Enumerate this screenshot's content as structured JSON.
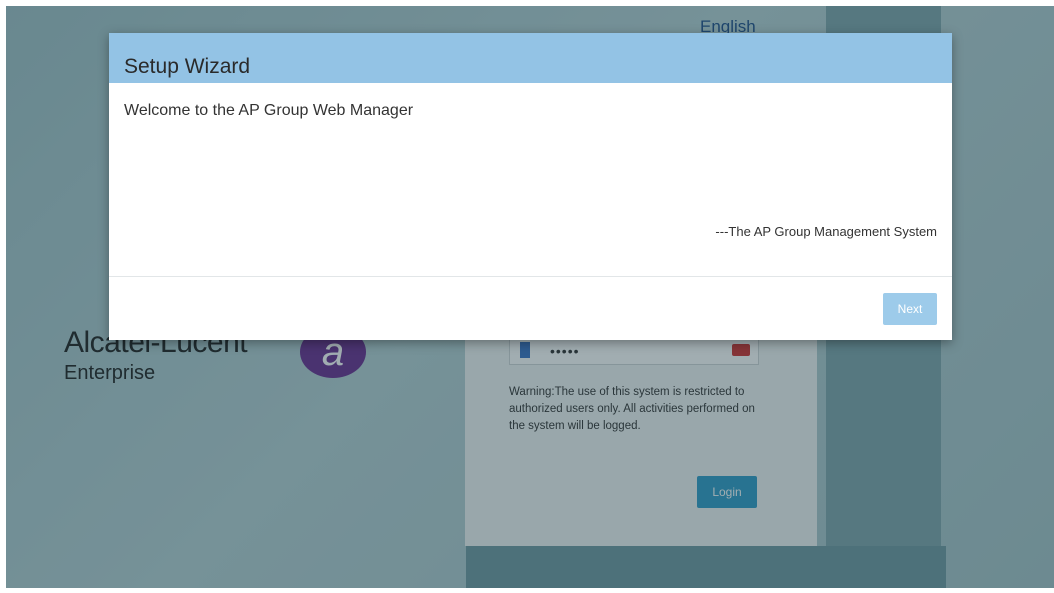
{
  "header": {
    "language": "English"
  },
  "brand": {
    "name": "Alcatel-Lucent",
    "sub": "Enterprise",
    "mark": "a"
  },
  "login": {
    "password_value": "•••••",
    "warning": "Warning:The use of this system is restricted to authorized users only. All activities performed on the system will be logged.",
    "login_label": "Login"
  },
  "modal": {
    "title": "Setup Wizard",
    "welcome": "Welcome to the AP Group Web Manager",
    "signature": "---The AP Group Management System",
    "next_label": "Next"
  },
  "colors": {
    "header_bg": "#93c3e5",
    "next_button": "#9dcbea",
    "login_button": "#2f9bc9",
    "brand_mark": "#6a2d8f"
  }
}
